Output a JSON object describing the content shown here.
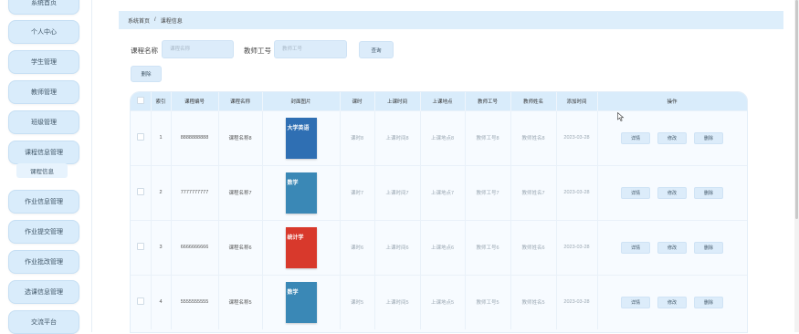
{
  "sidebar": {
    "items": [
      {
        "label": "系统首页"
      },
      {
        "label": "个人中心"
      },
      {
        "label": "学生管理"
      },
      {
        "label": "教师管理"
      },
      {
        "label": "班级管理"
      },
      {
        "label": "课程信息管理"
      },
      {
        "label": "作业信息管理"
      },
      {
        "label": "作业提交管理"
      },
      {
        "label": "作业批改管理"
      },
      {
        "label": "选课信息管理"
      },
      {
        "label": "交流平台"
      }
    ],
    "sub_item": {
      "label": "课程信息"
    }
  },
  "breadcrumb": {
    "home": "系统首页",
    "sep": "/",
    "current": "课程信息"
  },
  "search": {
    "course_name_label": "课程名称",
    "course_name_placeholder": "课程名称",
    "teacher_id_label": "教师工号",
    "teacher_id_placeholder": "教师工号",
    "query_button": "查询",
    "delete_button": "删除"
  },
  "table": {
    "headers": [
      "索引",
      "课程编号",
      "课程名称",
      "封面图片",
      "课时",
      "上课时间",
      "上课地点",
      "教师工号",
      "教师姓名",
      "添加时间",
      "操作"
    ],
    "rows": [
      {
        "index": "1",
        "code": "8888888888",
        "name": "课程名称8",
        "cover_text": "大学英语",
        "cover_color": "#2f6fb3",
        "hours": "课时8",
        "time": "上课时间8",
        "place": "上课地点8",
        "teacher_id": "教师工号8",
        "teacher_name": "教师姓名8",
        "added": "2023-03-28"
      },
      {
        "index": "2",
        "code": "7777777777",
        "name": "课程名称7",
        "cover_text": "数学",
        "cover_color": "#3a88b6",
        "hours": "课时7",
        "time": "上课时间7",
        "place": "上课地点7",
        "teacher_id": "教师工号7",
        "teacher_name": "教师姓名7",
        "added": "2023-03-28"
      },
      {
        "index": "3",
        "code": "6666666666",
        "name": "课程名称6",
        "cover_text": "统计学",
        "cover_color": "#d8392c",
        "hours": "课时6",
        "time": "上课时间6",
        "place": "上课地点6",
        "teacher_id": "教师工号6",
        "teacher_name": "教师姓名6",
        "added": "2023-03-28"
      },
      {
        "index": "4",
        "code": "5555555555",
        "name": "课程名称5",
        "cover_text": "数学",
        "cover_color": "#3a88b6",
        "hours": "课时5",
        "time": "上课时间5",
        "place": "上课地点5",
        "teacher_id": "教师工号5",
        "teacher_name": "教师姓名5",
        "added": "2023-03-28"
      }
    ],
    "actions": {
      "detail": "详情",
      "edit": "修改",
      "delete": "删除"
    }
  },
  "colors": {
    "accent": "#d9ecfb",
    "border": "#cfe3f5",
    "text": "#333333"
  }
}
